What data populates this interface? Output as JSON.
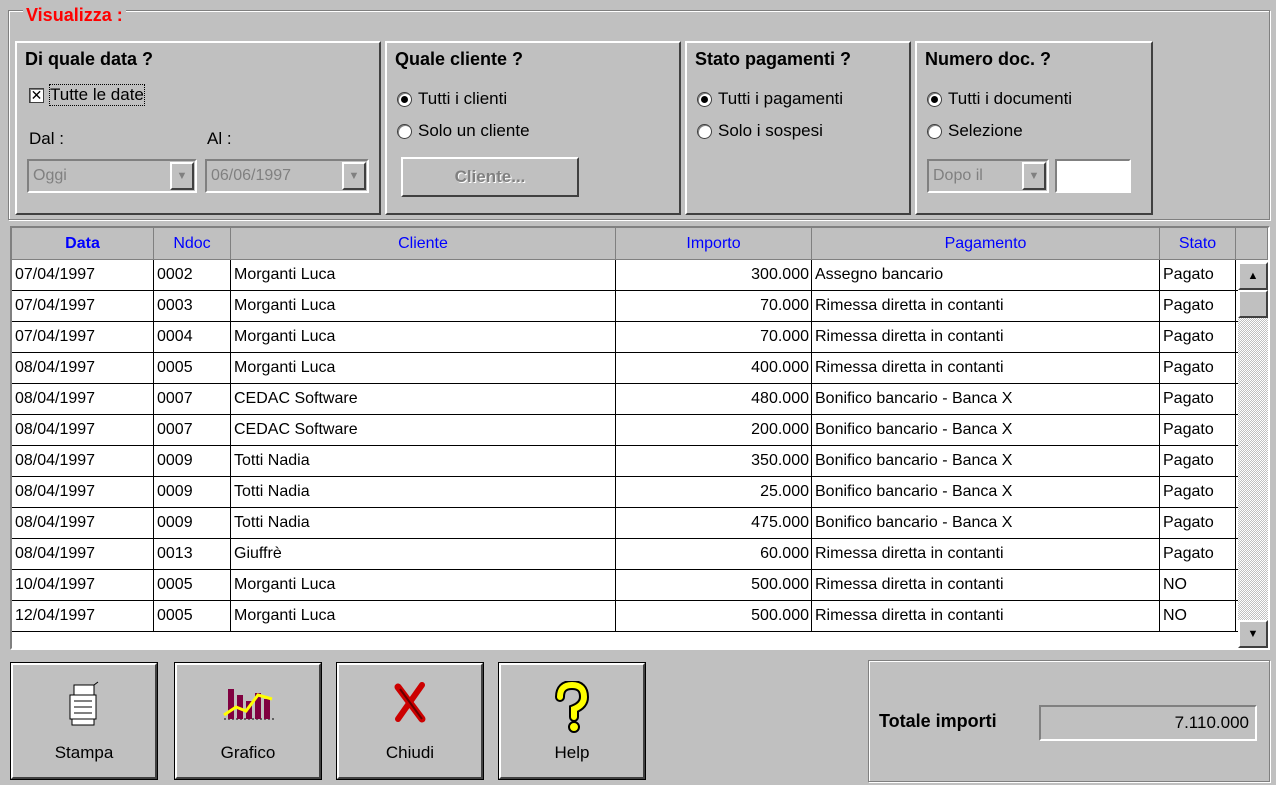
{
  "filters": {
    "legend": "Visualizza :",
    "date": {
      "title": "Di quale data ?",
      "all_dates_label": "Tutte le date",
      "from_label": "Dal :",
      "to_label": "Al :",
      "from_value": "Oggi",
      "to_value": "06/06/1997"
    },
    "client": {
      "title": "Quale cliente ?",
      "opt_all": "Tutti i clienti",
      "opt_one": "Solo un cliente",
      "button": "Cliente..."
    },
    "payment": {
      "title": "Stato pagamenti ?",
      "opt_all": "Tutti i pagamenti",
      "opt_pending": "Solo i sospesi"
    },
    "doc": {
      "title": "Numero doc. ?",
      "opt_all": "Tutti i documenti",
      "opt_sel": "Selezione",
      "combo_value": "Dopo il"
    }
  },
  "table": {
    "columns": [
      "Data",
      "Ndoc",
      "Cliente",
      "Importo",
      "Pagamento",
      "Stato"
    ],
    "rows": [
      [
        "07/04/1997",
        "0002",
        "Morganti Luca",
        "300.000",
        "Assegno bancario",
        "Pagato"
      ],
      [
        "07/04/1997",
        "0003",
        "Morganti Luca",
        "70.000",
        "Rimessa diretta in contanti",
        "Pagato"
      ],
      [
        "07/04/1997",
        "0004",
        "Morganti Luca",
        "70.000",
        "Rimessa diretta in contanti",
        "Pagato"
      ],
      [
        "08/04/1997",
        "0005",
        "Morganti Luca",
        "400.000",
        "Rimessa diretta in contanti",
        "Pagato"
      ],
      [
        "08/04/1997",
        "0007",
        "CEDAC Software",
        "480.000",
        "Bonifico bancario - Banca X",
        "Pagato"
      ],
      [
        "08/04/1997",
        "0007",
        "CEDAC Software",
        "200.000",
        "Bonifico bancario - Banca X",
        "Pagato"
      ],
      [
        "08/04/1997",
        "0009",
        "Totti Nadia",
        "350.000",
        "Bonifico bancario - Banca X",
        "Pagato"
      ],
      [
        "08/04/1997",
        "0009",
        "Totti Nadia",
        "25.000",
        "Bonifico bancario - Banca X",
        "Pagato"
      ],
      [
        "08/04/1997",
        "0009",
        "Totti Nadia",
        "475.000",
        "Bonifico bancario - Banca X",
        "Pagato"
      ],
      [
        "08/04/1997",
        "0013",
        "Giuffrè",
        "60.000",
        "Rimessa diretta in contanti",
        "Pagato"
      ],
      [
        "10/04/1997",
        "0005",
        "Morganti Luca",
        "500.000",
        "Rimessa diretta in contanti",
        "NO"
      ],
      [
        "12/04/1997",
        "0005",
        "Morganti Luca",
        "500.000",
        "Rimessa diretta in contanti",
        "NO"
      ]
    ]
  },
  "toolbar": {
    "print": "Stampa",
    "chart": "Grafico",
    "close": "Chiudi",
    "help": "Help"
  },
  "totals": {
    "label": "Totale importi",
    "value": "7.110.000"
  },
  "colors": {
    "legend": "#ff0000",
    "header_text": "#0000ff",
    "face": "#c0c0c0"
  }
}
